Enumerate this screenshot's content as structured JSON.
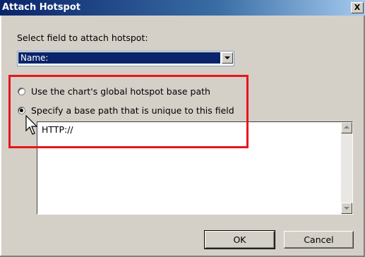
{
  "window": {
    "title": "Attach Hotspot",
    "close_label": "X"
  },
  "field_select": {
    "label": "Select field to attach hotspot:",
    "selected_value": "Name:"
  },
  "radio_options": [
    {
      "label": "Use the chart's global hotspot base path",
      "checked": false
    },
    {
      "label": "Specify a base path that is unique to this field",
      "checked": true
    }
  ],
  "base_path_textarea": {
    "value": "HTTP://"
  },
  "buttons": {
    "ok": "OK",
    "cancel": "Cancel"
  },
  "colors": {
    "highlight": "#e8141c",
    "titlebar": "#0a246a",
    "selection": "#0a246a"
  },
  "icons": [
    "close-icon",
    "dropdown-arrow-icon",
    "scroll-up-icon",
    "scroll-down-icon",
    "mouse-cursor-icon"
  ]
}
